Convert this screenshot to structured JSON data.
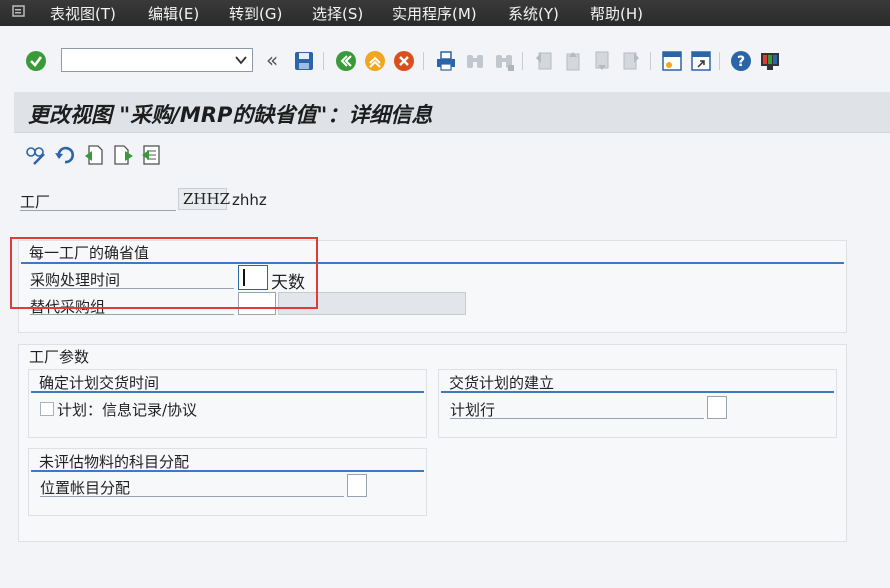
{
  "menu": {
    "items": [
      {
        "label": "表视图(T)",
        "name": "menu-table-view"
      },
      {
        "label": "编辑(E)",
        "name": "menu-edit"
      },
      {
        "label": "转到(G)",
        "name": "menu-goto"
      },
      {
        "label": "选择(S)",
        "name": "menu-selection"
      },
      {
        "label": "实用程序(M)",
        "name": "menu-utilities"
      },
      {
        "label": "系统(Y)",
        "name": "menu-system"
      },
      {
        "label": "帮助(H)",
        "name": "menu-help"
      }
    ]
  },
  "toolbar": {
    "command_value": "",
    "back_symbol": "«"
  },
  "page": {
    "title": "更改视图 \"采购/MRP的缺省值\"：详细信息"
  },
  "plant": {
    "label": "工厂",
    "code": "ZHHZ",
    "name": "zhhz"
  },
  "defaults_group": {
    "title": "每一工厂的确省值",
    "processing_time_label": "采购处理时间",
    "processing_time_value": "",
    "days_unit": "天数",
    "alt_purch_group_label": "替代采购组"
  },
  "plant_params": {
    "title": "工厂参数",
    "delivery_time": {
      "title": "确定计划交货时间",
      "checkbox_label": "计划：信息记录/协议"
    },
    "schedule_creation": {
      "title": "交货计划的建立",
      "field_label": "计划行"
    },
    "unvalued_material": {
      "title": "未评估物料的科目分配",
      "field_label": "位置帐目分配"
    }
  },
  "colors": {
    "menubar": "#2f2f2f",
    "accent_line": "#3b7bbf",
    "highlight": "#e03a3a"
  }
}
